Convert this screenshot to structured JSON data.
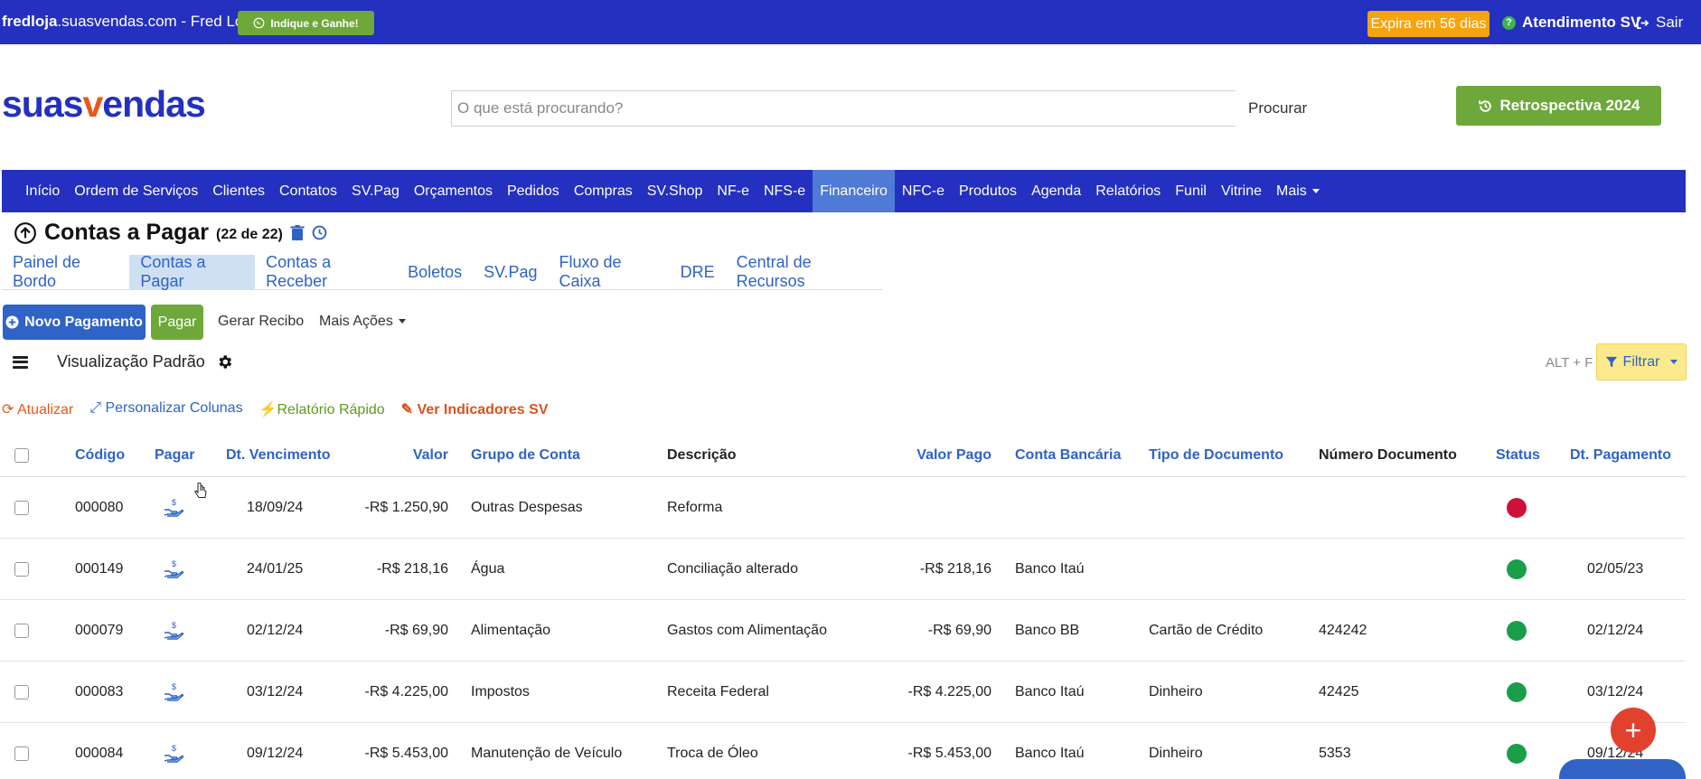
{
  "topbar": {
    "site_bold": "fredloja",
    "site_rest": ".suasvendas.com - Fred Loja",
    "indique": "Indique e Ganhe!",
    "expira": "Expira em 56 dias",
    "atendimento": "Atendimento SV",
    "sair": "Sair"
  },
  "header": {
    "logo_a": "suas",
    "logo_v": "v",
    "logo_b": "endas",
    "search_placeholder": "O que está procurando?",
    "procurar": "Procurar",
    "retro": "Retrospectiva 2024"
  },
  "nav": [
    "Início",
    "Ordem de Serviços",
    "Clientes",
    "Contatos",
    "SV.Pag",
    "Orçamentos",
    "Pedidos",
    "Compras",
    "SV.Shop",
    "NF-e",
    "NFS-e",
    "Financeiro",
    "NFC-e",
    "Produtos",
    "Agenda",
    "Relatórios",
    "Funil",
    "Vitrine",
    "Mais"
  ],
  "page": {
    "title": "Contas a Pagar",
    "count": "(22 de 22)"
  },
  "subtabs": [
    "Painel de Bordo",
    "Contas a Pagar",
    "Contas a Receber",
    "Boletos",
    "SV.Pag",
    "Fluxo de Caixa",
    "DRE",
    "Central de Recursos"
  ],
  "actions": {
    "novo": "Novo Pagamento",
    "pagar": "Pagar",
    "recibo": "Gerar Recibo",
    "mais": "Mais Ações"
  },
  "view": {
    "label": "Visualização Padrão",
    "shortcut": "ALT + F",
    "filtrar": "Filtrar"
  },
  "links": {
    "atualizar": "Atualizar",
    "personalizar": "Personalizar Colunas",
    "relatorio": "Relatório Rápido",
    "indicadores": "Ver Indicadores SV"
  },
  "table": {
    "headers": {
      "codigo": "Código",
      "pagar": "Pagar",
      "vencimento": "Dt. Vencimento",
      "valor": "Valor",
      "grupo": "Grupo de Conta",
      "descricao": "Descrição",
      "valor_pago": "Valor Pago",
      "conta": "Conta Bancária",
      "tipo": "Tipo de Documento",
      "numero": "Número Documento",
      "status": "Status",
      "pagamento": "Dt. Pagamento"
    },
    "rows": [
      {
        "codigo": "000080",
        "vencimento": "18/09/24",
        "valor": "-R$ 1.250,90",
        "grupo": "Outras Despesas",
        "descricao": "Reforma",
        "valor_pago": "",
        "conta": "",
        "tipo": "",
        "numero": "",
        "status_color": "#d0103a",
        "pagamento": ""
      },
      {
        "codigo": "000149",
        "vencimento": "24/01/25",
        "valor": "-R$ 218,16",
        "grupo": "Água",
        "descricao": "Conciliação alterado",
        "valor_pago": "-R$ 218,16",
        "conta": "Banco Itaú",
        "tipo": "",
        "numero": "",
        "status_color": "#1a9e4a",
        "pagamento": "02/05/23"
      },
      {
        "codigo": "000079",
        "vencimento": "02/12/24",
        "valor": "-R$ 69,90",
        "grupo": "Alimentação",
        "descricao": "Gastos com Alimentação",
        "valor_pago": "-R$ 69,90",
        "conta": "Banco BB",
        "tipo": "Cartão de Crédito",
        "numero": "424242",
        "status_color": "#1a9e4a",
        "pagamento": "02/12/24"
      },
      {
        "codigo": "000083",
        "vencimento": "03/12/24",
        "valor": "-R$ 4.225,00",
        "grupo": "Impostos",
        "descricao": "Receita Federal",
        "valor_pago": "-R$ 4.225,00",
        "conta": "Banco Itaú",
        "tipo": "Dinheiro",
        "numero": "42425",
        "status_color": "#1a9e4a",
        "pagamento": "03/12/24"
      },
      {
        "codigo": "000084",
        "vencimento": "09/12/24",
        "valor": "-R$ 5.453,00",
        "grupo": "Manutenção de Veículo",
        "descricao": "Troca de Óleo",
        "valor_pago": "-R$ 5.453,00",
        "conta": "Banco Itaú",
        "tipo": "Dinheiro",
        "numero": "5353",
        "status_color": "#1a9e4a",
        "pagamento": "09/12/24"
      }
    ]
  }
}
